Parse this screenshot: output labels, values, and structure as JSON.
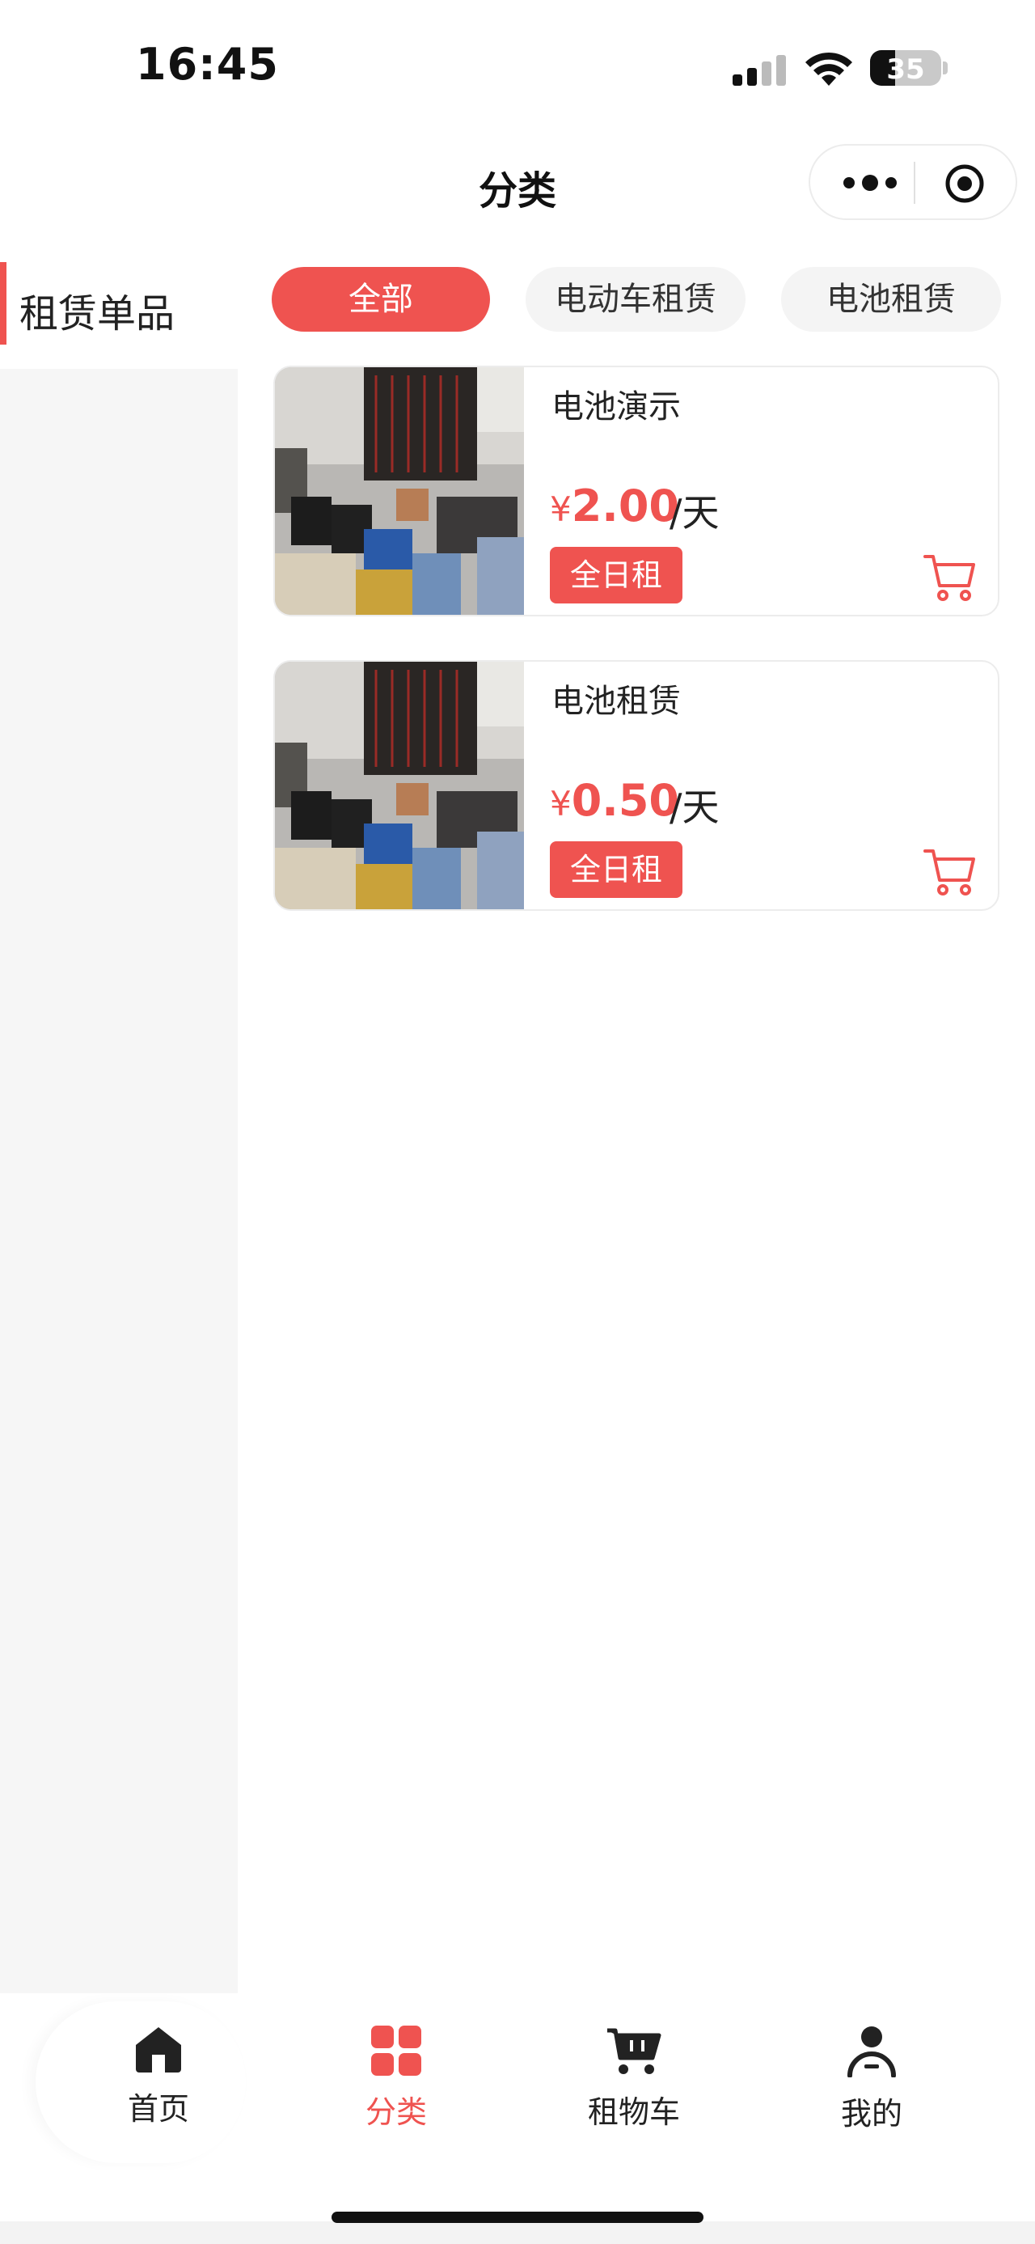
{
  "status_bar": {
    "time": "16:45",
    "battery": "35",
    "battery_level": 0.35
  },
  "navbar": {
    "title": "分类",
    "more_icon": "more-dots-icon",
    "close_icon": "target-circle-icon"
  },
  "sidebar": {
    "items": [
      {
        "label": "租赁单品",
        "active": true
      }
    ]
  },
  "tabs": [
    {
      "label": "全部",
      "active": true
    },
    {
      "label": "电动车租赁",
      "active": false
    },
    {
      "label": "电池租赁",
      "active": false
    }
  ],
  "products": [
    {
      "name": "电池演示",
      "currency": "¥",
      "price": "2.00",
      "unit": "/天",
      "badge": "全日租",
      "cart_icon": "cart-icon"
    },
    {
      "name": "电池租赁",
      "currency": "¥",
      "price": "0.50",
      "unit": "/天",
      "badge": "全日租",
      "cart_icon": "cart-icon"
    }
  ],
  "tabbar": {
    "items": [
      {
        "label": "首页",
        "icon": "home-icon",
        "active": false
      },
      {
        "label": "分类",
        "icon": "category-grid-icon",
        "active": true
      },
      {
        "label": "租物车",
        "icon": "cart-icon",
        "active": false
      },
      {
        "label": "我的",
        "icon": "user-icon",
        "active": false
      }
    ]
  },
  "colors": {
    "accent": "#ef5350",
    "sidebar_bg": "#f6f6f6",
    "text": "#222222"
  }
}
